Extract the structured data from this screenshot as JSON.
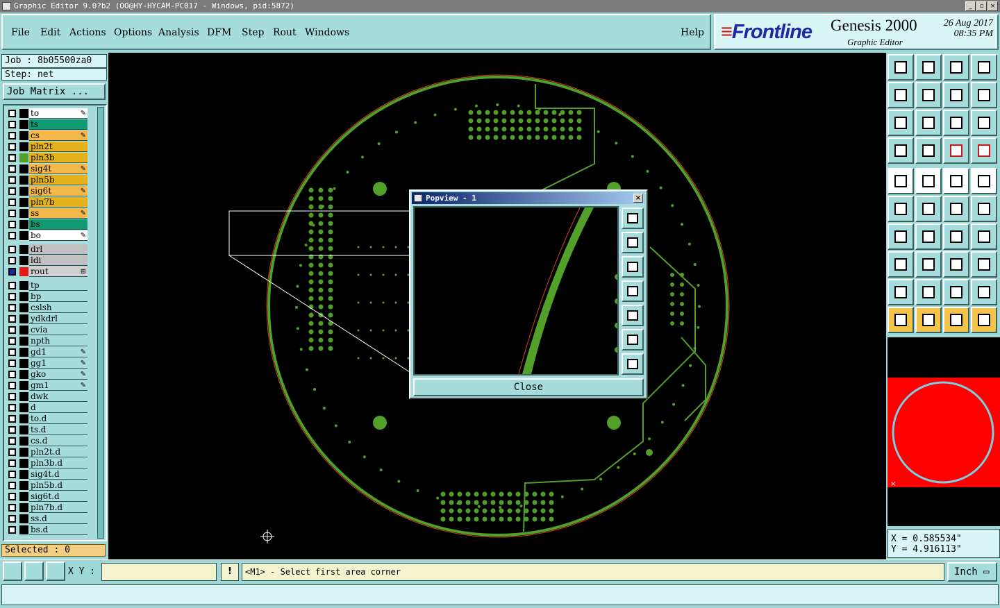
{
  "window": {
    "title": "Graphic Editor 9.0?b2 (OO@HY-HYCAM-PC017 - Windows, pid:5872)"
  },
  "menu": [
    "File",
    "Edit",
    "Actions",
    "Options",
    "Analysis",
    "DFM",
    "Step",
    "Rout",
    "Windows"
  ],
  "help_label": "Help",
  "brand": {
    "logo_text": "Frontline",
    "product": "Genesis 2000",
    "subtitle": "Graphic Editor",
    "date": "26 Aug 2017",
    "time": "08:35 PM"
  },
  "job": {
    "label": "Job : 8b05500za0",
    "step": "Step: net",
    "matrix_button": "Job Matrix ..."
  },
  "layers": [
    {
      "name": "to",
      "color": "#ffffff",
      "mark": "✎"
    },
    {
      "name": "ts",
      "color": "#109a72",
      "mark": ""
    },
    {
      "name": "cs",
      "color": "#f3b94a",
      "mark": "✎"
    },
    {
      "name": "pln2t",
      "color": "#e3b21c",
      "mark": ""
    },
    {
      "name": "pln3b",
      "color": "#e3b21c",
      "mark": "",
      "swatch": "#52a02a"
    },
    {
      "name": "sig4t",
      "color": "#f3b94a",
      "mark": "✎"
    },
    {
      "name": "pln5b",
      "color": "#e3b21c",
      "mark": ""
    },
    {
      "name": "sig6t",
      "color": "#f3b94a",
      "mark": "✎"
    },
    {
      "name": "pln7b",
      "color": "#e3b21c",
      "mark": ""
    },
    {
      "name": "ss",
      "color": "#f3b94a",
      "mark": "✎"
    },
    {
      "name": "bs",
      "color": "#109a72",
      "mark": ""
    },
    {
      "name": "bo",
      "color": "#ffffff",
      "mark": "✎"
    },
    {
      "name": "drl",
      "color": "#c0c0c0",
      "mark": ""
    },
    {
      "name": "ldi",
      "color": "#c0c0c0",
      "mark": ""
    },
    {
      "name": "rout",
      "color": "#d0d0d0",
      "mark": "⊞",
      "swatch": "#e81818",
      "checkfill": "#1a2aa8"
    },
    {
      "name": "tp",
      "color": "#a6dcdc",
      "mark": ""
    },
    {
      "name": "bp",
      "color": "#a6dcdc",
      "mark": ""
    },
    {
      "name": "cslsh",
      "color": "#a6dcdc",
      "mark": ""
    },
    {
      "name": "ydkdrl",
      "color": "#a6dcdc",
      "mark": ""
    },
    {
      "name": "cvia",
      "color": "#a6dcdc",
      "mark": ""
    },
    {
      "name": "npth",
      "color": "#a6dcdc",
      "mark": ""
    },
    {
      "name": "gd1",
      "color": "#a6dcdc",
      "mark": "✎"
    },
    {
      "name": "gg1",
      "color": "#a6dcdc",
      "mark": "✎"
    },
    {
      "name": "gko",
      "color": "#a6dcdc",
      "mark": "✎"
    },
    {
      "name": "gm1",
      "color": "#a6dcdc",
      "mark": "✎"
    },
    {
      "name": "dwk",
      "color": "#a6dcdc",
      "mark": ""
    },
    {
      "name": "d",
      "color": "#a6dcdc",
      "mark": ""
    },
    {
      "name": "to.d",
      "color": "#a6dcdc",
      "mark": ""
    },
    {
      "name": "ts.d",
      "color": "#a6dcdc",
      "mark": ""
    },
    {
      "name": "cs.d",
      "color": "#a6dcdc",
      "mark": ""
    },
    {
      "name": "pln2t.d",
      "color": "#a6dcdc",
      "mark": ""
    },
    {
      "name": "pln3b.d",
      "color": "#a6dcdc",
      "mark": ""
    },
    {
      "name": "sig4t.d",
      "color": "#a6dcdc",
      "mark": ""
    },
    {
      "name": "pln5b.d",
      "color": "#a6dcdc",
      "mark": ""
    },
    {
      "name": "sig6t.d",
      "color": "#a6dcdc",
      "mark": ""
    },
    {
      "name": "pln7b.d",
      "color": "#a6dcdc",
      "mark": ""
    },
    {
      "name": "ss.d",
      "color": "#a6dcdc",
      "mark": ""
    },
    {
      "name": "bs.d",
      "color": "#a6dcdc",
      "mark": ""
    }
  ],
  "selected": "Selected : 0",
  "popview": {
    "title": "Popview - 1",
    "close_label": "Close"
  },
  "coords": {
    "x": "X = 0.585534\"",
    "y": "Y = 4.916113\""
  },
  "command": {
    "xy_label": "X Y :",
    "xy_value": "",
    "prompt": "<M1> - Select first area corner",
    "unit": "Inch"
  },
  "colors": {
    "board": "#52a02a",
    "outline": "#d04028",
    "canvas": "#000000",
    "panel": "#a6dcdc"
  }
}
